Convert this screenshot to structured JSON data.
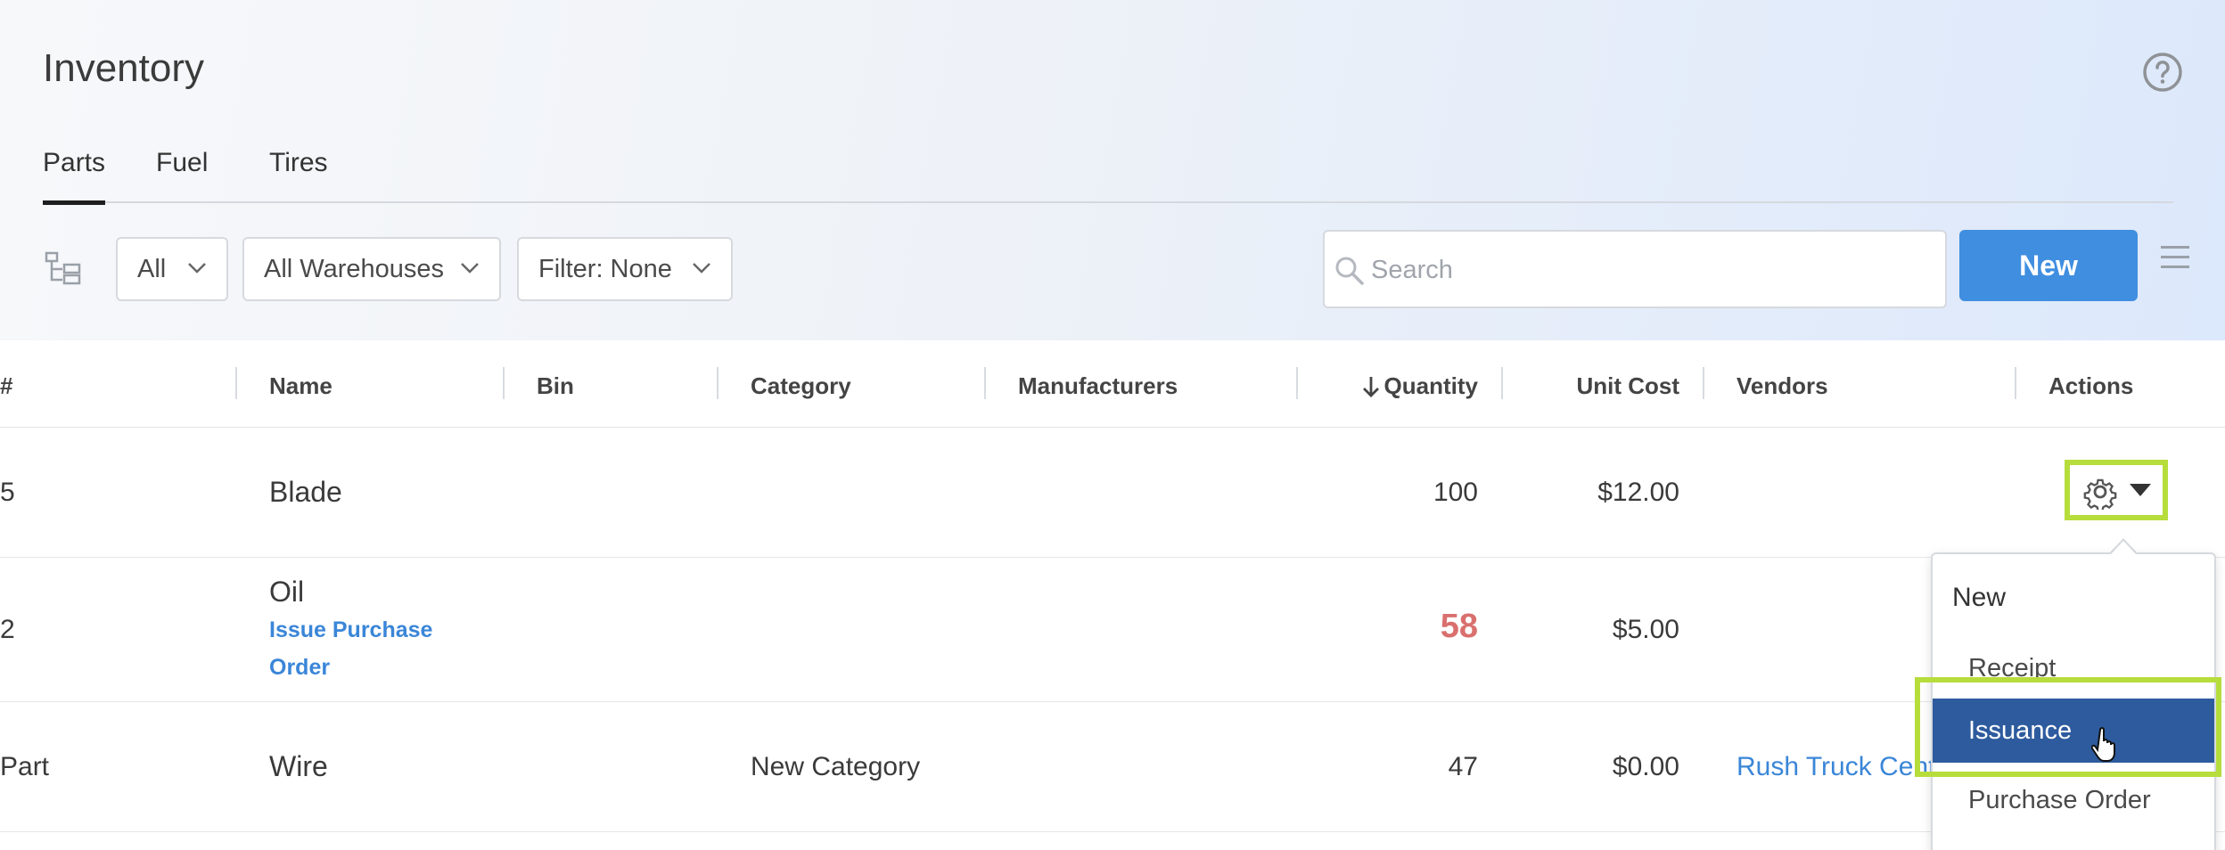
{
  "page": {
    "title": "Inventory"
  },
  "tabs": [
    {
      "label": "Parts",
      "active": true
    },
    {
      "label": "Fuel",
      "active": false
    },
    {
      "label": "Tires",
      "active": false
    }
  ],
  "toolbar": {
    "filters": [
      {
        "label": "All"
      },
      {
        "label": "All Warehouses"
      },
      {
        "label": "Filter: None"
      }
    ],
    "search_placeholder": "Search",
    "new_label": "New"
  },
  "table": {
    "columns": [
      "#",
      "Name",
      "Bin",
      "Category",
      "Manufacturers",
      "Quantity",
      "Unit Cost",
      "Vendors",
      "Actions"
    ],
    "sort_column": "Quantity",
    "sort_direction": "descending",
    "rows": [
      {
        "number": "5",
        "name": "Blade",
        "bin": "",
        "category": "",
        "manufacturers": "",
        "quantity": "100",
        "unit_cost": "$12.00",
        "vendors": ""
      },
      {
        "number": "2",
        "name": "Oil",
        "link_line1": "Issue Purchase",
        "link_line2": "Order",
        "bin": "",
        "category": "",
        "manufacturers": "",
        "quantity": "58",
        "quantity_low": true,
        "unit_cost": "$5.00",
        "vendors": ""
      },
      {
        "number": "Part",
        "name": "Wire",
        "bin": "",
        "category": "New Category",
        "manufacturers": "",
        "quantity": "47",
        "unit_cost": "$0.00",
        "vendors": "Rush Truck Cente"
      }
    ]
  },
  "actions_menu": {
    "header": "New",
    "items": [
      {
        "label": "Receipt",
        "selected": false
      },
      {
        "label": "Issuance",
        "selected": true
      },
      {
        "label": "Purchase Order",
        "selected": false
      }
    ]
  },
  "colors": {
    "accent": "#3f8ee0",
    "highlight": "#b6dd3c",
    "selected_item": "#2e5b9e",
    "low_quantity": "#d9706e",
    "link": "#3a86d8"
  },
  "icons": [
    "help-icon",
    "tree-view-icon",
    "chevron-down-icon",
    "search-icon",
    "hamburger-menu-icon",
    "gear-icon",
    "caret-down-icon",
    "sort-down-arrow-icon",
    "hand-cursor-icon"
  ]
}
